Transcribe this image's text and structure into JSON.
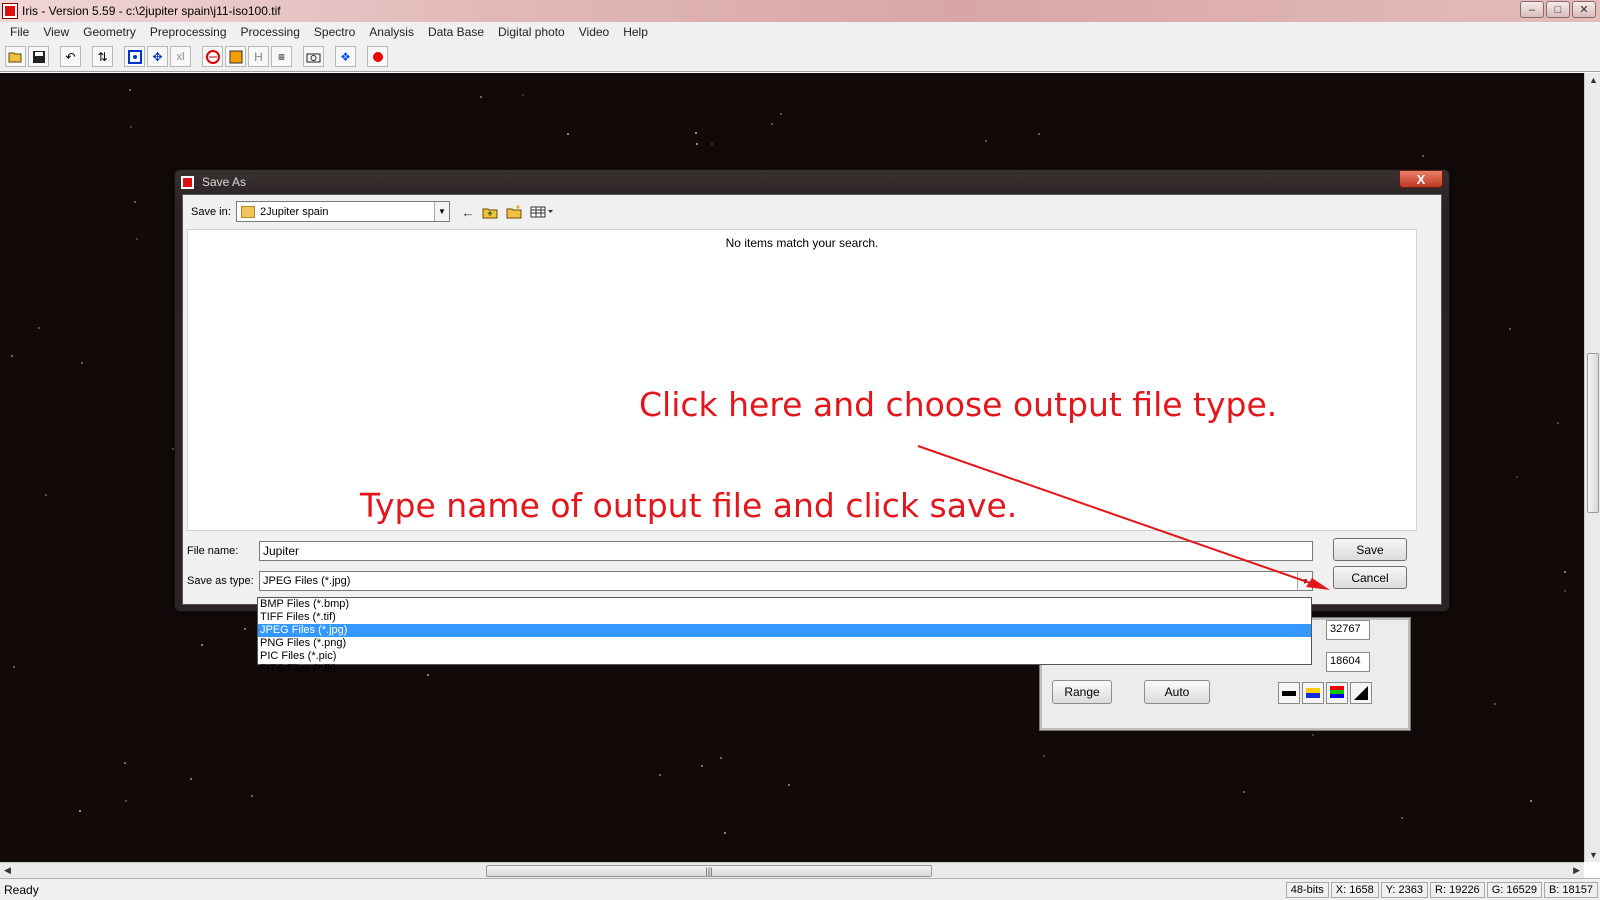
{
  "window": {
    "title": "Iris - Version 5.59 - c:\\2jupiter spain\\j11-iso100.tif",
    "controls": [
      "–",
      "□",
      "✕"
    ]
  },
  "menu": [
    "File",
    "View",
    "Geometry",
    "Preprocessing",
    "Processing",
    "Spectro",
    "Analysis",
    "Data Base",
    "Digital photo",
    "Video",
    "Help"
  ],
  "toolbar": {
    "icons": [
      "open-folder-icon",
      "save-disk-icon",
      "undo-icon",
      "settings-icon",
      "zoom-icon",
      "move-icon",
      "xl-icon",
      "slice-icon",
      "palette-icon",
      "h-icon",
      "list-icon",
      "camera-icon",
      "blue-star-icon",
      "red-dot-icon"
    ],
    "xl_text": "xl",
    "h_text": "H"
  },
  "dialog": {
    "title": "Save As",
    "save_in_label": "Save in:",
    "save_in_value": "2Jupiter spain",
    "empty_message": "No items match your search.",
    "file_name_label": "File name:",
    "file_name_value": "Jupiter",
    "save_as_type_label": "Save as type:",
    "save_as_type_value": "JPEG Files (*.jpg)",
    "save_button": "Save",
    "cancel_button": "Cancel",
    "close_glyph": "X"
  },
  "file_types": [
    {
      "label": "BMP Files (*.bmp)",
      "selected": false
    },
    {
      "label": "TIFF Files (*.tif)",
      "selected": false
    },
    {
      "label": "JPEG Files (*.jpg)",
      "selected": true
    },
    {
      "label": "PNG Files (*.png)",
      "selected": false
    },
    {
      "label": "PIC Files (*.pic)",
      "selected": false
    },
    {
      "label": "FITS Files (*.fit)",
      "selected": false
    }
  ],
  "threshold": {
    "high_value": "32767",
    "low_value": "18604",
    "range_button": "Range",
    "auto_button": "Auto"
  },
  "annotations": {
    "top": "Click here and choose output file type.",
    "bottom": "Type name of output file and click save."
  },
  "status": {
    "ready": "Ready",
    "depth": "48-bits",
    "x": "X: 1658",
    "y": "Y: 2363",
    "r": "R: 19226",
    "g": "G: 16529",
    "b": "B: 18157"
  },
  "colors": {
    "annotation": "#e3161b",
    "selection": "#3399ff"
  }
}
